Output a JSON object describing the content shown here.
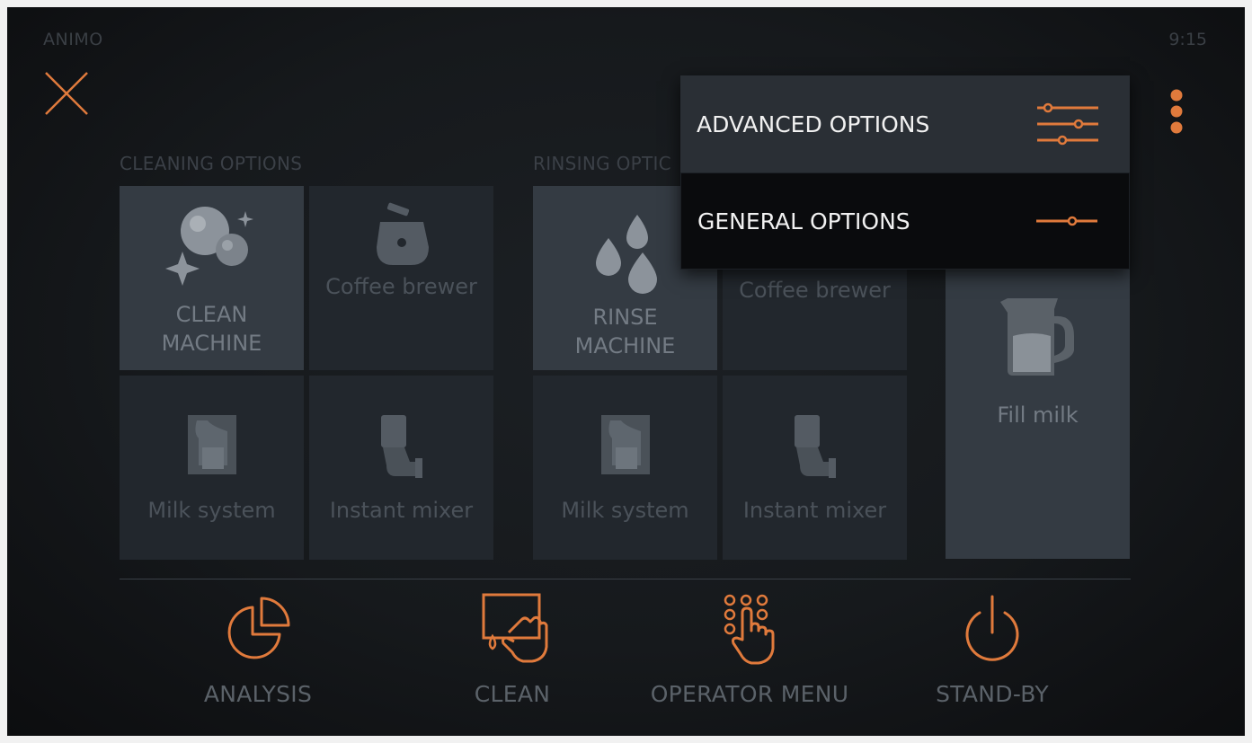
{
  "header": {
    "brand": "ANIMO",
    "time": "9:15"
  },
  "cleaning": {
    "title": "CLEANING OPTIONS",
    "clean_machine": "CLEAN\nMACHINE",
    "coffee_brewer": "Coffee brewer",
    "milk_system": "Milk system",
    "instant_mixer": "Instant mixer"
  },
  "rinsing": {
    "title": "RINSING OPTIC",
    "rinse_machine": "RINSE\nMACHINE",
    "coffee_brewer": "Coffee brewer",
    "milk_system": "Milk system",
    "instant_mixer": "Instant mixer"
  },
  "fill_milk": {
    "label": "Fill milk"
  },
  "bottom_nav": {
    "analysis": "ANALYSIS",
    "clean": "CLEAN",
    "operator_menu": "OPERATOR MENU",
    "standby": "STAND-BY"
  },
  "dropdown": {
    "advanced": "ADVANCED OPTIONS",
    "general": "GENERAL OPTIONS"
  },
  "colors": {
    "accent": "#e07a3c",
    "tile": "#22272d",
    "tile_highlight": "#343b43",
    "menu_dark": "#0a0b0d",
    "menu_light": "#2a2f35"
  },
  "icons": {
    "close": "close-icon",
    "more": "kebab-icon",
    "clean_machine": "sparkle-bubbles-icon",
    "coffee_brewer": "brewer-icon",
    "milk_system": "milk-system-icon",
    "instant_mixer": "mixer-icon",
    "rinse_machine": "water-drops-icon",
    "fill_milk": "milk-jug-icon",
    "analysis": "pie-chart-icon",
    "clean": "clean-hand-icon",
    "operator_menu": "keypad-touch-icon",
    "standby": "power-icon",
    "advanced": "sliders-icon",
    "general": "slider-icon"
  }
}
